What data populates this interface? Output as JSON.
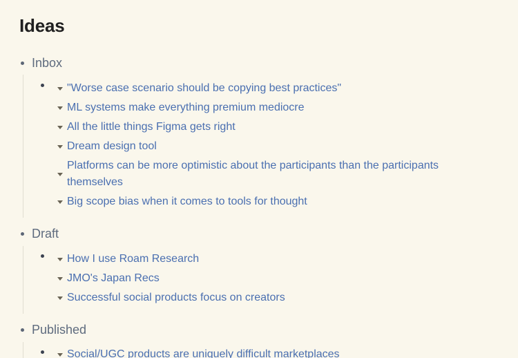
{
  "page": {
    "title": "Ideas"
  },
  "sections": [
    {
      "label": "Inbox",
      "items": [
        "\"Worse case scenario should be copying best practices\"",
        "ML systems make everything premium mediocre",
        "All the little things Figma gets right",
        "Dream design tool",
        "Platforms can be more optimistic about the participants than the participants themselves",
        "Big scope bias when it comes to tools for thought"
      ]
    },
    {
      "label": "Draft",
      "items": [
        "How I use Roam Research",
        "JMO's Japan Recs",
        "Successful social products focus on creators"
      ]
    },
    {
      "label": "Published",
      "items": [
        "Social/UGC products are uniquely difficult marketplaces"
      ]
    }
  ],
  "icons": {
    "section_bullet": "bullet-dot",
    "child_bullet": "bullet-dot",
    "item_toggle": "caret-down"
  },
  "colors": {
    "background": "#faf7ec",
    "title": "#202020",
    "section_label": "#5e6b7e",
    "link": "#4a6fb0",
    "caret": "#6a6455"
  }
}
